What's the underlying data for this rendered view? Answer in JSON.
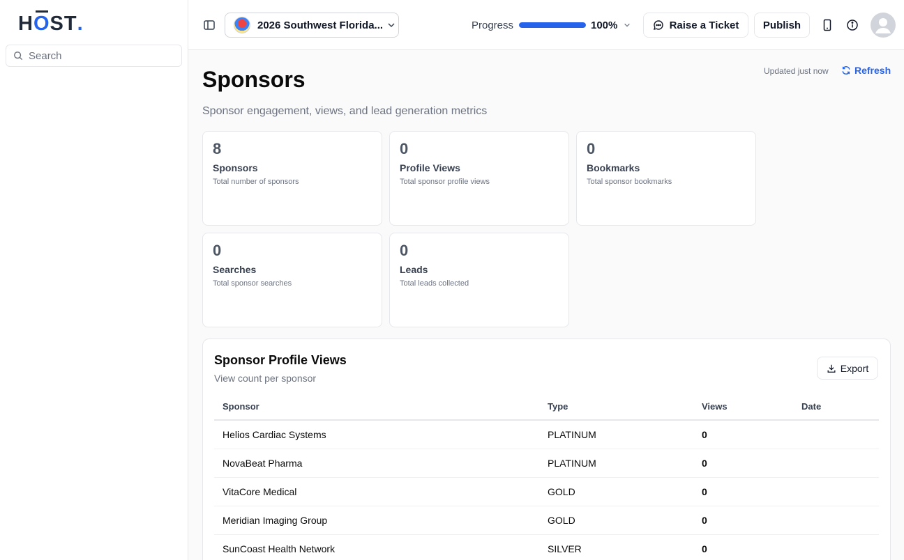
{
  "brand": {
    "logo_prefix": "H",
    "logo_o": "O",
    "logo_suffix": "ST",
    "logo_dot": "."
  },
  "sidebar": {
    "search_placeholder": "Search"
  },
  "header": {
    "event_name": "2026 Southwest Florida...",
    "progress_label": "Progress",
    "progress_value": "100%",
    "progress_fraction": 1.0,
    "raise_ticket_label": "Raise a Ticket",
    "publish_label": "Publish"
  },
  "page": {
    "title": "Sponsors",
    "subtitle": "Sponsor engagement, views, and lead generation metrics",
    "updated_text": "Updated just now",
    "refresh_label": "Refresh"
  },
  "stats": [
    {
      "value": "8",
      "label": "Sponsors",
      "desc": "Total number of sponsors"
    },
    {
      "value": "0",
      "label": "Profile Views",
      "desc": "Total sponsor profile views"
    },
    {
      "value": "0",
      "label": "Bookmarks",
      "desc": "Total sponsor bookmarks"
    },
    {
      "value": "0",
      "label": "Searches",
      "desc": "Total sponsor searches"
    },
    {
      "value": "0",
      "label": "Leads",
      "desc": "Total leads collected"
    }
  ],
  "profile_views": {
    "title": "Sponsor Profile Views",
    "subtitle": "View count per sponsor",
    "export_label": "Export",
    "columns": [
      "Sponsor",
      "Type",
      "Views",
      "Date"
    ],
    "rows": [
      {
        "sponsor": "Helios Cardiac Systems",
        "type": "PLATINUM",
        "views": "0",
        "date": ""
      },
      {
        "sponsor": "NovaBeat Pharma",
        "type": "PLATINUM",
        "views": "0",
        "date": ""
      },
      {
        "sponsor": "VitaCore Medical",
        "type": "GOLD",
        "views": "0",
        "date": ""
      },
      {
        "sponsor": "Meridian Imaging Group",
        "type": "GOLD",
        "views": "0",
        "date": ""
      },
      {
        "sponsor": "SunCoast Health Network",
        "type": "SILVER",
        "views": "0",
        "date": ""
      }
    ]
  },
  "colors": {
    "accent": "#2563eb",
    "text": "#111827",
    "muted": "#6b7280",
    "border": "#e5e7eb"
  }
}
